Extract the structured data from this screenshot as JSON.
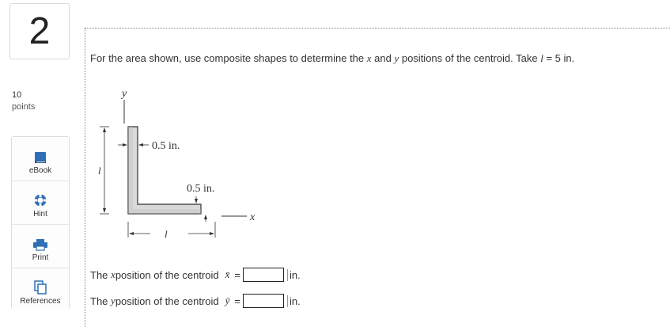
{
  "question": {
    "number": "2",
    "points_value": "10",
    "points_label": "points",
    "prompt_before": "For the area shown, use composite shapes to determine the ",
    "prompt_x": "x",
    "prompt_and": " and ",
    "prompt_y": "y",
    "prompt_after": " positions of the centroid. Take ",
    "prompt_l": "l",
    "prompt_end": " = 5 in."
  },
  "tools": [
    {
      "label": "eBook",
      "icon": "book-icon"
    },
    {
      "label": "Hint",
      "icon": "lifebuoy-icon"
    },
    {
      "label": "Print",
      "icon": "printer-icon"
    },
    {
      "label": "References",
      "icon": "documents-icon"
    }
  ],
  "figure": {
    "y_axis": "y",
    "x_axis": "x",
    "top_dim": "0.5 in.",
    "side_dim": "0.5 in.",
    "height_dim": "l",
    "width_dim": "l"
  },
  "answers": [
    {
      "prefix": "The ",
      "var": "x",
      "text": " position of the centroid",
      "symbol": "x̄",
      "equals": "=",
      "value": "",
      "unit": "in."
    },
    {
      "prefix": "The ",
      "var": "y",
      "text": " position of the centroid",
      "symbol": "ȳ",
      "equals": "=",
      "value": "",
      "unit": "in."
    }
  ],
  "colors": {
    "accent_blue": "#2f6fb5",
    "shape_fill": "#d9d9d9",
    "border": "#dcdcdc"
  }
}
